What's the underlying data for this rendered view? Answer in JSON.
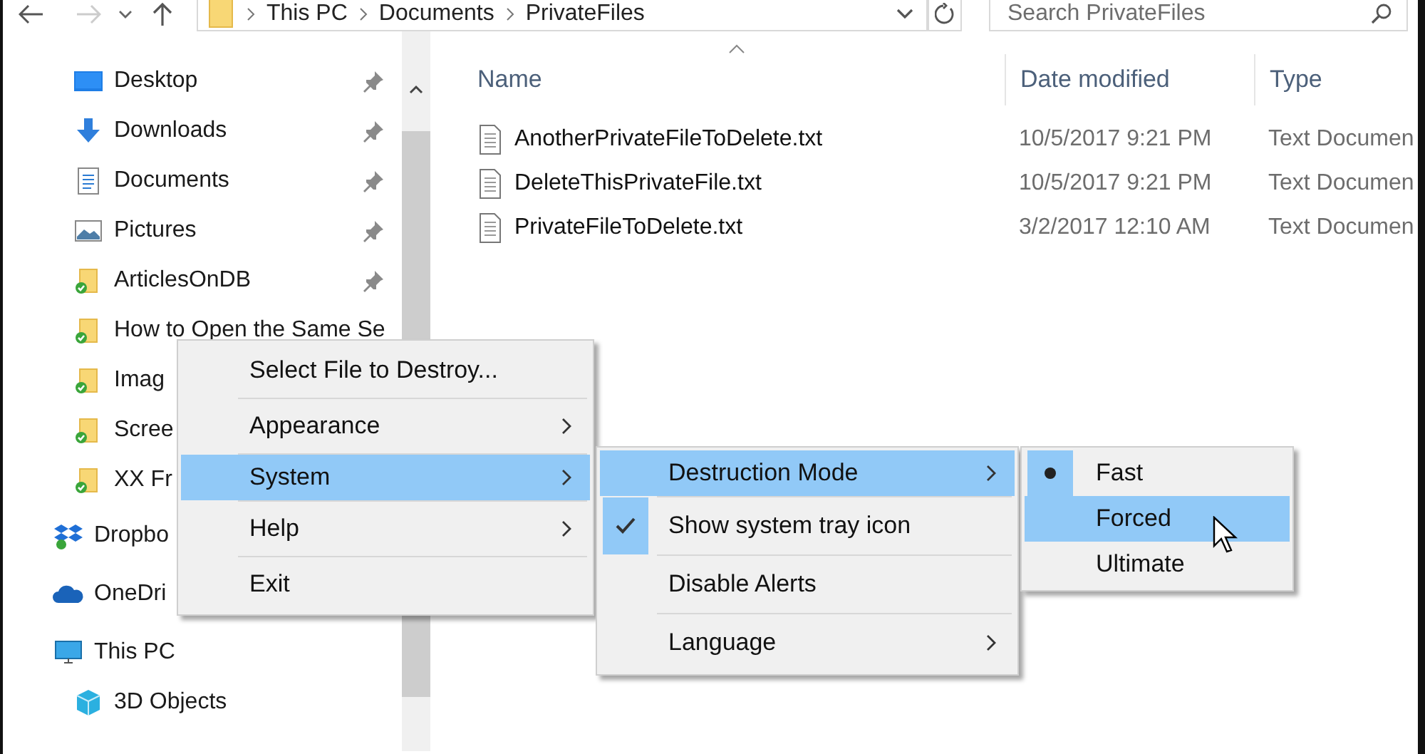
{
  "nav": {
    "address": [
      "This PC",
      "Documents",
      "PrivateFiles"
    ],
    "search": {
      "placeholder": "Search PrivateFiles"
    }
  },
  "sidebar": {
    "quick_access": [
      {
        "label": "Desktop",
        "kind": "desktop",
        "pinned": true
      },
      {
        "label": "Downloads",
        "kind": "download",
        "pinned": true
      },
      {
        "label": "Documents",
        "kind": "document",
        "pinned": true
      },
      {
        "label": "Pictures",
        "kind": "picture",
        "pinned": true
      },
      {
        "label": "ArticlesOnDB",
        "kind": "folder",
        "pinned": true
      },
      {
        "label": "How to Open the Same Se",
        "kind": "folder",
        "pinned": false
      },
      {
        "label": "Imag",
        "kind": "folder",
        "pinned": false
      },
      {
        "label": "Scree",
        "kind": "folder",
        "pinned": false
      },
      {
        "label": "XX Fr",
        "kind": "folder",
        "pinned": false
      }
    ],
    "locations": [
      {
        "label": "Dropbo",
        "kind": "dropbox"
      },
      {
        "label": "OneDri",
        "kind": "onedrive"
      },
      {
        "label": "This PC",
        "kind": "pc",
        "children": [
          {
            "label": "3D Objects",
            "kind": "cube"
          }
        ]
      }
    ]
  },
  "file_list": {
    "columns": [
      "Name",
      "Date modified",
      "Type"
    ],
    "rows": [
      {
        "name": "AnotherPrivateFileToDelete.txt",
        "date": "10/5/2017 9:21 PM",
        "type": "Text Documen"
      },
      {
        "name": "DeleteThisPrivateFile.txt",
        "date": "10/5/2017 9:21 PM",
        "type": "Text Documen"
      },
      {
        "name": "PrivateFileToDelete.txt",
        "date": "3/2/2017 12:10 AM",
        "type": "Text Documen"
      }
    ]
  },
  "context_menu": {
    "items": [
      {
        "label": "Select File to Destroy...",
        "submenu": false,
        "highlighted": false
      },
      {
        "label": "Appearance",
        "submenu": true,
        "highlighted": false
      },
      {
        "label": "System",
        "submenu": true,
        "highlighted": true
      },
      {
        "label": "Help",
        "submenu": true,
        "highlighted": false
      },
      {
        "label": "Exit",
        "submenu": false,
        "highlighted": false
      }
    ]
  },
  "system_submenu": {
    "items": [
      {
        "label": "Destruction Mode",
        "submenu": true,
        "highlighted": true,
        "checked": false
      },
      {
        "label": "Show system tray icon",
        "submenu": false,
        "highlighted": false,
        "checked": true
      },
      {
        "label": "Disable Alerts",
        "submenu": false,
        "highlighted": false,
        "checked": false
      },
      {
        "label": "Language",
        "submenu": true,
        "highlighted": false,
        "checked": false
      }
    ]
  },
  "mode_submenu": {
    "items": [
      {
        "label": "Fast",
        "selected": true,
        "highlighted": false
      },
      {
        "label": "Forced",
        "selected": false,
        "highlighted": true
      },
      {
        "label": "Ultimate",
        "selected": false,
        "highlighted": false
      }
    ]
  }
}
